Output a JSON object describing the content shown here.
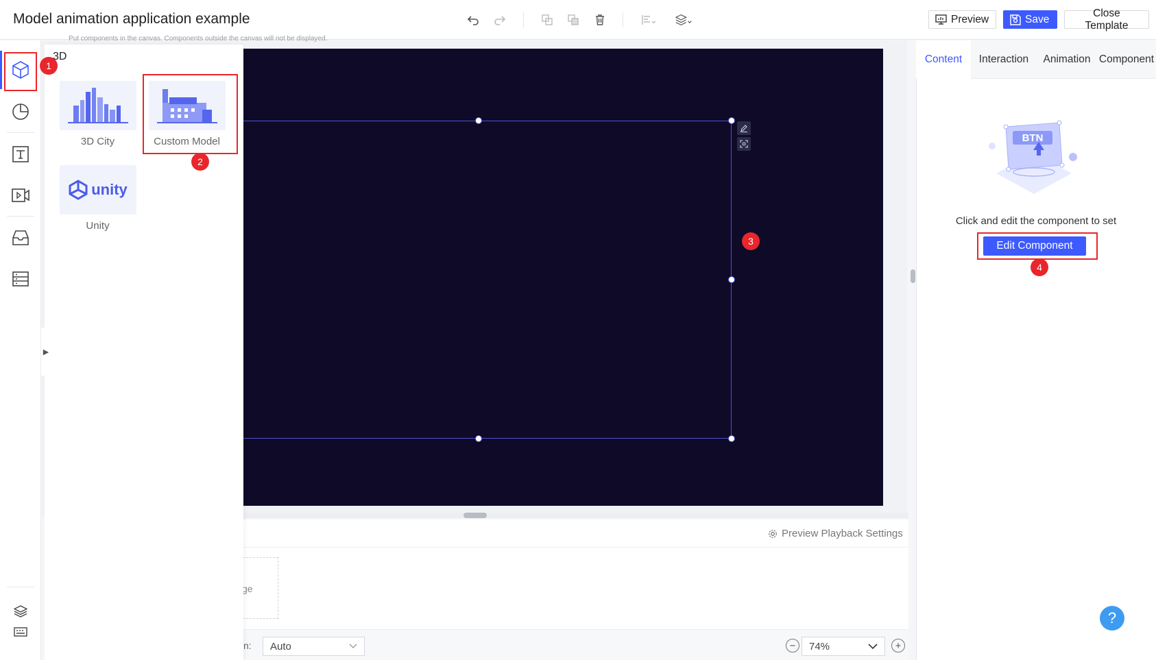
{
  "header": {
    "title": "Model animation application example",
    "toolbar_icons": [
      "undo-icon",
      "redo-icon",
      "copy-icon",
      "paste-icon",
      "delete-icon",
      "align-icon",
      "layers-icon"
    ],
    "preview_label": "Preview",
    "save_label": "Save",
    "close_label": "Close Template"
  },
  "rail": {
    "items": [
      "3d-cube-icon",
      "chart-pie-icon",
      "text-icon",
      "video-icon",
      "inbox-icon",
      "list-icon"
    ],
    "bottom_items": [
      "layers-icon",
      "keyboard-icon"
    ]
  },
  "panel": {
    "heading": "3D",
    "components": [
      {
        "label": "3D City"
      },
      {
        "label": "Custom Model"
      },
      {
        "label": "Unity",
        "thumb_text": "unity"
      }
    ]
  },
  "canvas": {
    "note": "Put components in the canvas. Components outside the canvas will not be displayed.",
    "mini_tools": [
      "edit-icon",
      "screenshot-icon"
    ]
  },
  "bottom": {
    "preview_playback_label": "Preview Playback Settings",
    "page_card_text": "ge",
    "strip_label": "n:",
    "select_value": "Auto",
    "zoom_value": "74%"
  },
  "right": {
    "tabs": [
      "Content",
      "Interaction",
      "Animation",
      "Component"
    ],
    "illus_text": "BTN",
    "hint": "Click and edit the component to set",
    "edit_button": "Edit Component",
    "help": "?"
  },
  "annotations": [
    "1",
    "2",
    "3",
    "4"
  ],
  "colors": {
    "accent": "#3d5afe",
    "canvas": "#0f0a28",
    "annotation": "#e8262c",
    "help": "#3d9bf0"
  }
}
